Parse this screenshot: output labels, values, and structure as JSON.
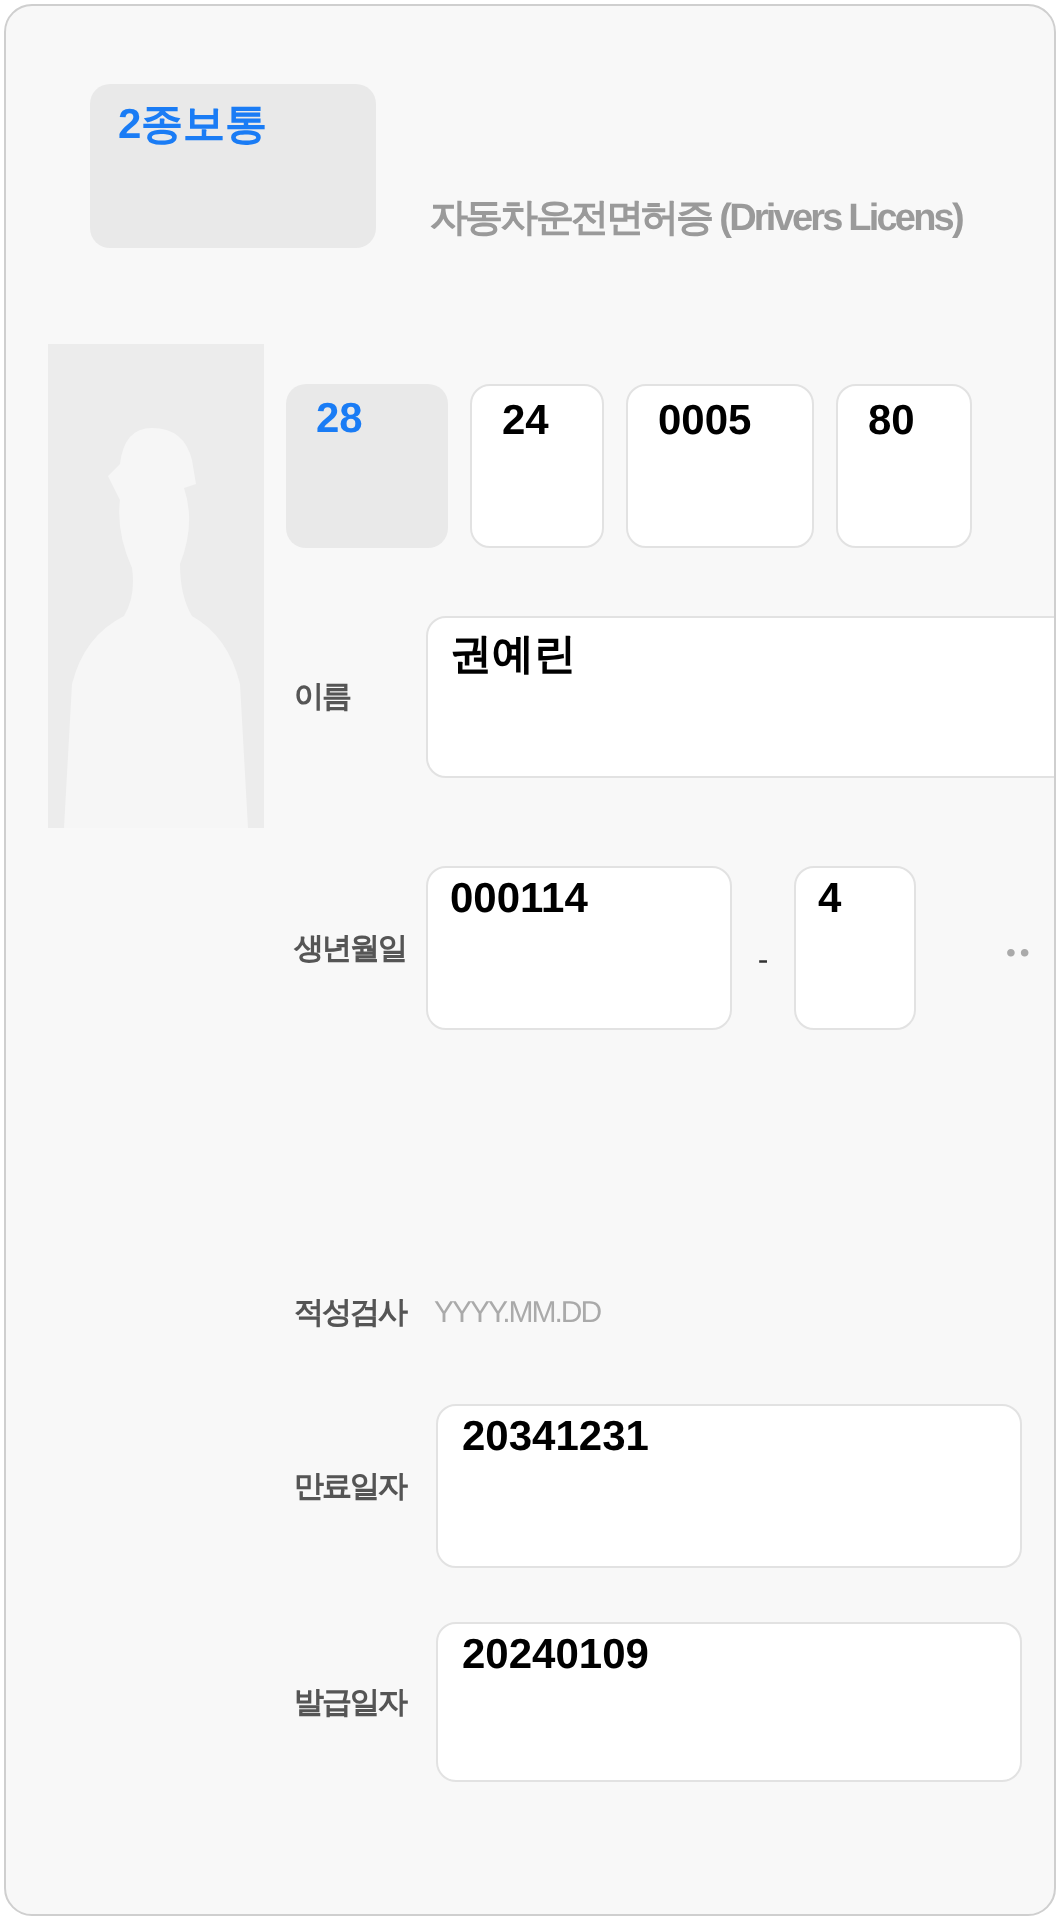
{
  "license_type": {
    "value": "2종보통"
  },
  "title": "자동차운전면허증 (Drivers Licens)",
  "license_number": [
    {
      "kind": "select",
      "value": "28"
    },
    {
      "kind": "input",
      "value": "24"
    },
    {
      "kind": "input",
      "value": "0005"
    },
    {
      "kind": "input",
      "value": "80"
    }
  ],
  "name": {
    "label": "이름",
    "value": "권예린"
  },
  "birth": {
    "label": "생년월일",
    "value": "000114",
    "separator": "-",
    "gender_digit": "4",
    "mask": "••"
  },
  "aptitude_test": {
    "label": "적성검사",
    "placeholder": "YYYY.MM.DD"
  },
  "expiry_date": {
    "label": "만료일자",
    "value": "20341231"
  },
  "issue_date": {
    "label": "발급일자",
    "value": "20240109"
  }
}
